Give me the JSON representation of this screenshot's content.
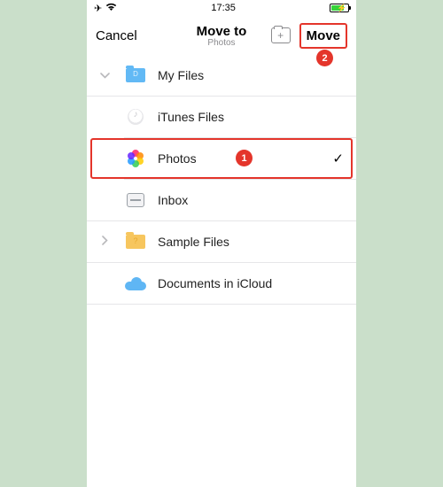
{
  "status": {
    "time": "17:35"
  },
  "nav": {
    "cancel": "Cancel",
    "title": "Move to",
    "subtitle": "Photos",
    "move": "Move"
  },
  "rows": {
    "myfiles": "My Files",
    "itunes": "iTunes Files",
    "photos": "Photos",
    "inbox": "Inbox",
    "sample": "Sample Files",
    "icloud": "Documents in iCloud"
  },
  "callouts": {
    "one": "1",
    "two": "2"
  }
}
